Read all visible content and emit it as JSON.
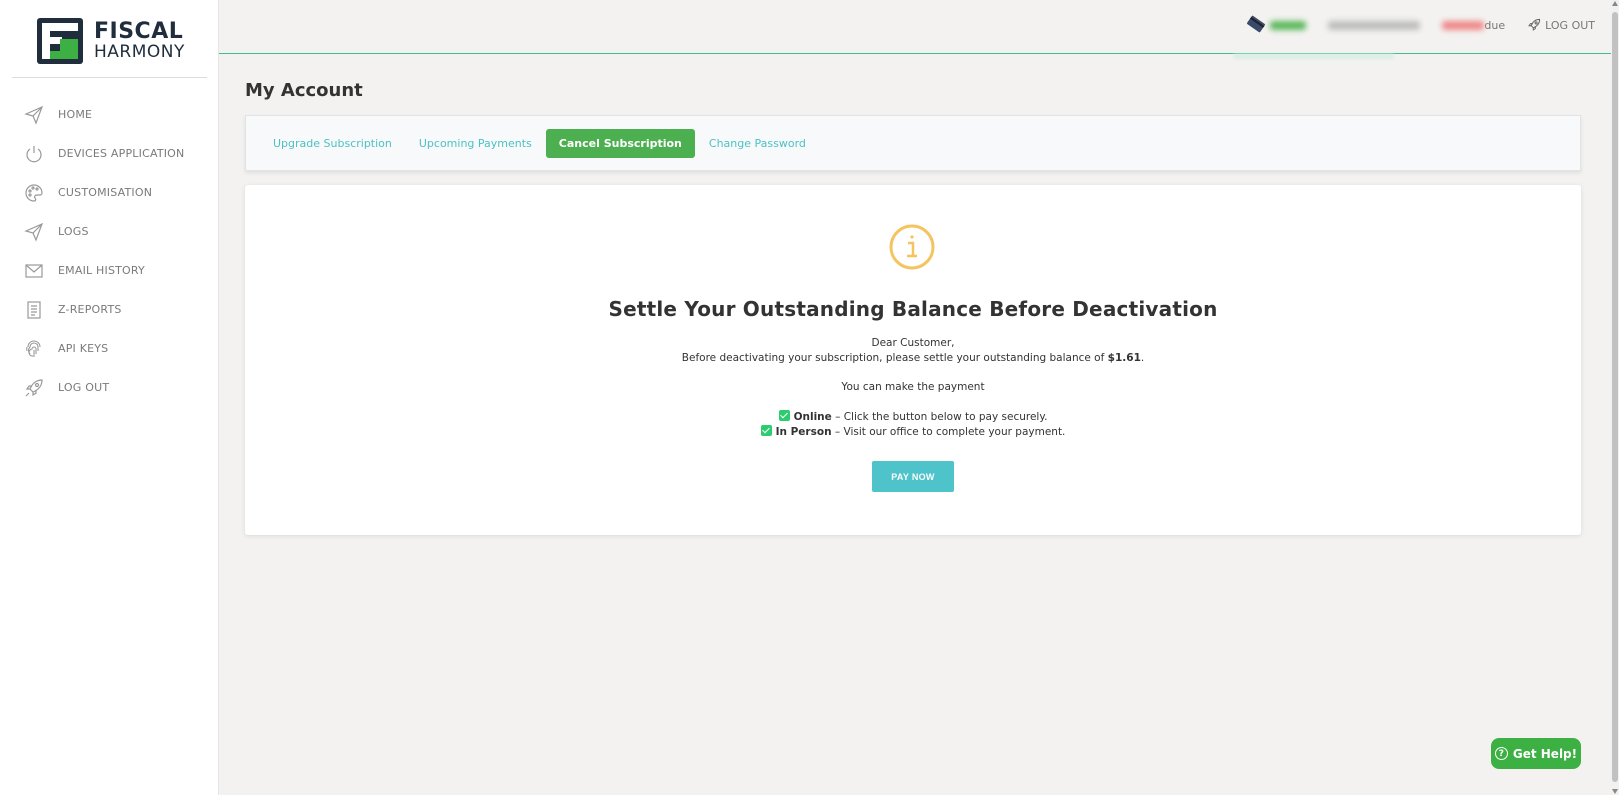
{
  "brand": {
    "line1": "FISCAL",
    "line2": "HARMONY"
  },
  "sidebar": {
    "items": [
      {
        "label": "HOME",
        "icon": "paper-plane-icon"
      },
      {
        "label": "DEVICES APPLICATION",
        "icon": "power-icon"
      },
      {
        "label": "CUSTOMISATION",
        "icon": "palette-icon"
      },
      {
        "label": "LOGS",
        "icon": "paper-plane-icon"
      },
      {
        "label": "EMAIL HISTORY",
        "icon": "envelope-icon"
      },
      {
        "label": "Z-REPORTS",
        "icon": "document-icon"
      },
      {
        "label": "API KEYS",
        "icon": "fingerprint-icon"
      },
      {
        "label": "LOG OUT",
        "icon": "rocket-icon"
      }
    ]
  },
  "topbar": {
    "due_text": "due",
    "logout": "LOG OUT"
  },
  "page": {
    "title": "My Account"
  },
  "tabs": [
    {
      "label": "Upgrade Subscription",
      "active": false
    },
    {
      "label": "Upcoming Payments",
      "active": false
    },
    {
      "label": "Cancel Subscription",
      "active": true
    },
    {
      "label": "Change Password",
      "active": false
    }
  ],
  "notice": {
    "heading": "Settle Your Outstanding Balance Before Deactivation",
    "greeting": "Dear Customer,",
    "message_prefix": "Before deactivating your subscription, please settle your outstanding balance of ",
    "amount": "$1.61",
    "message_suffix": ".",
    "payment_intro": "You can make the payment",
    "option_online_title": "Online",
    "option_online_desc": " – Click the button below to pay securely.",
    "option_inperson_title": "In Person",
    "option_inperson_desc": " – Visit our office to complete your payment.",
    "pay_button": "PAY NOW"
  },
  "help": {
    "label": "Get Help!"
  },
  "colors": {
    "brand_green": "#4caf50",
    "accent_teal": "#4ec3c9",
    "info_yellow": "#f5c45e",
    "topbar_line": "#3fbf8c"
  }
}
